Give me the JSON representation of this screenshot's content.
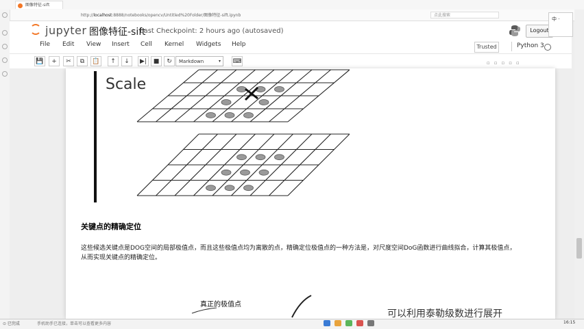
{
  "browser": {
    "tab_title": "图像特征-sift",
    "url_host": "localhost",
    "url_rest": ":8888/notebooks/opencv/Untitled%20Folder/图像特征-sift.ipynb",
    "search_placeholder": "点此搜索"
  },
  "header": {
    "logo_text": "jupyter",
    "notebook_title": "图像特征-sift",
    "checkpoint": "Last Checkpoint: 2 hours ago (autosaved)",
    "logout_label": "Logout",
    "ime_label": "中 ·"
  },
  "menu": [
    "File",
    "Edit",
    "View",
    "Insert",
    "Cell",
    "Kernel",
    "Widgets",
    "Help"
  ],
  "kernel": {
    "trusted_label": "Trusted",
    "name": "Python 3"
  },
  "toolbar": {
    "buttons": [
      "💾",
      "+",
      "✂",
      "⧉",
      "📋",
      "↑",
      "↓",
      "▶|",
      "■",
      "↻"
    ],
    "cell_type": "Markdown",
    "cell_type_arrow": "▾",
    "keyboard_icon": "⌨"
  },
  "content": {
    "scale_label": "Scale",
    "heading": "关键点的精确定位",
    "paragraph_line1": "这些候选关键点是DOG空间的局部极值点，而且这些极值点均为离散的点，精确定位极值点的一种方法是，对尺度空间DoG函数进行曲线拟合，计算其极值点，",
    "paragraph_line2": "从而实现关键点的精确定位。",
    "figure2_label": "真正的极值点",
    "handwritten": "可以利用泰勒级数进行展开"
  },
  "status": {
    "left": "⊙ 已完成",
    "message": "手机助手已连接，单击可以查看更多内容",
    "time": "16:15"
  },
  "colors": {
    "jupyter_orange": "#f37726",
    "link_blue": "#337ab7"
  }
}
